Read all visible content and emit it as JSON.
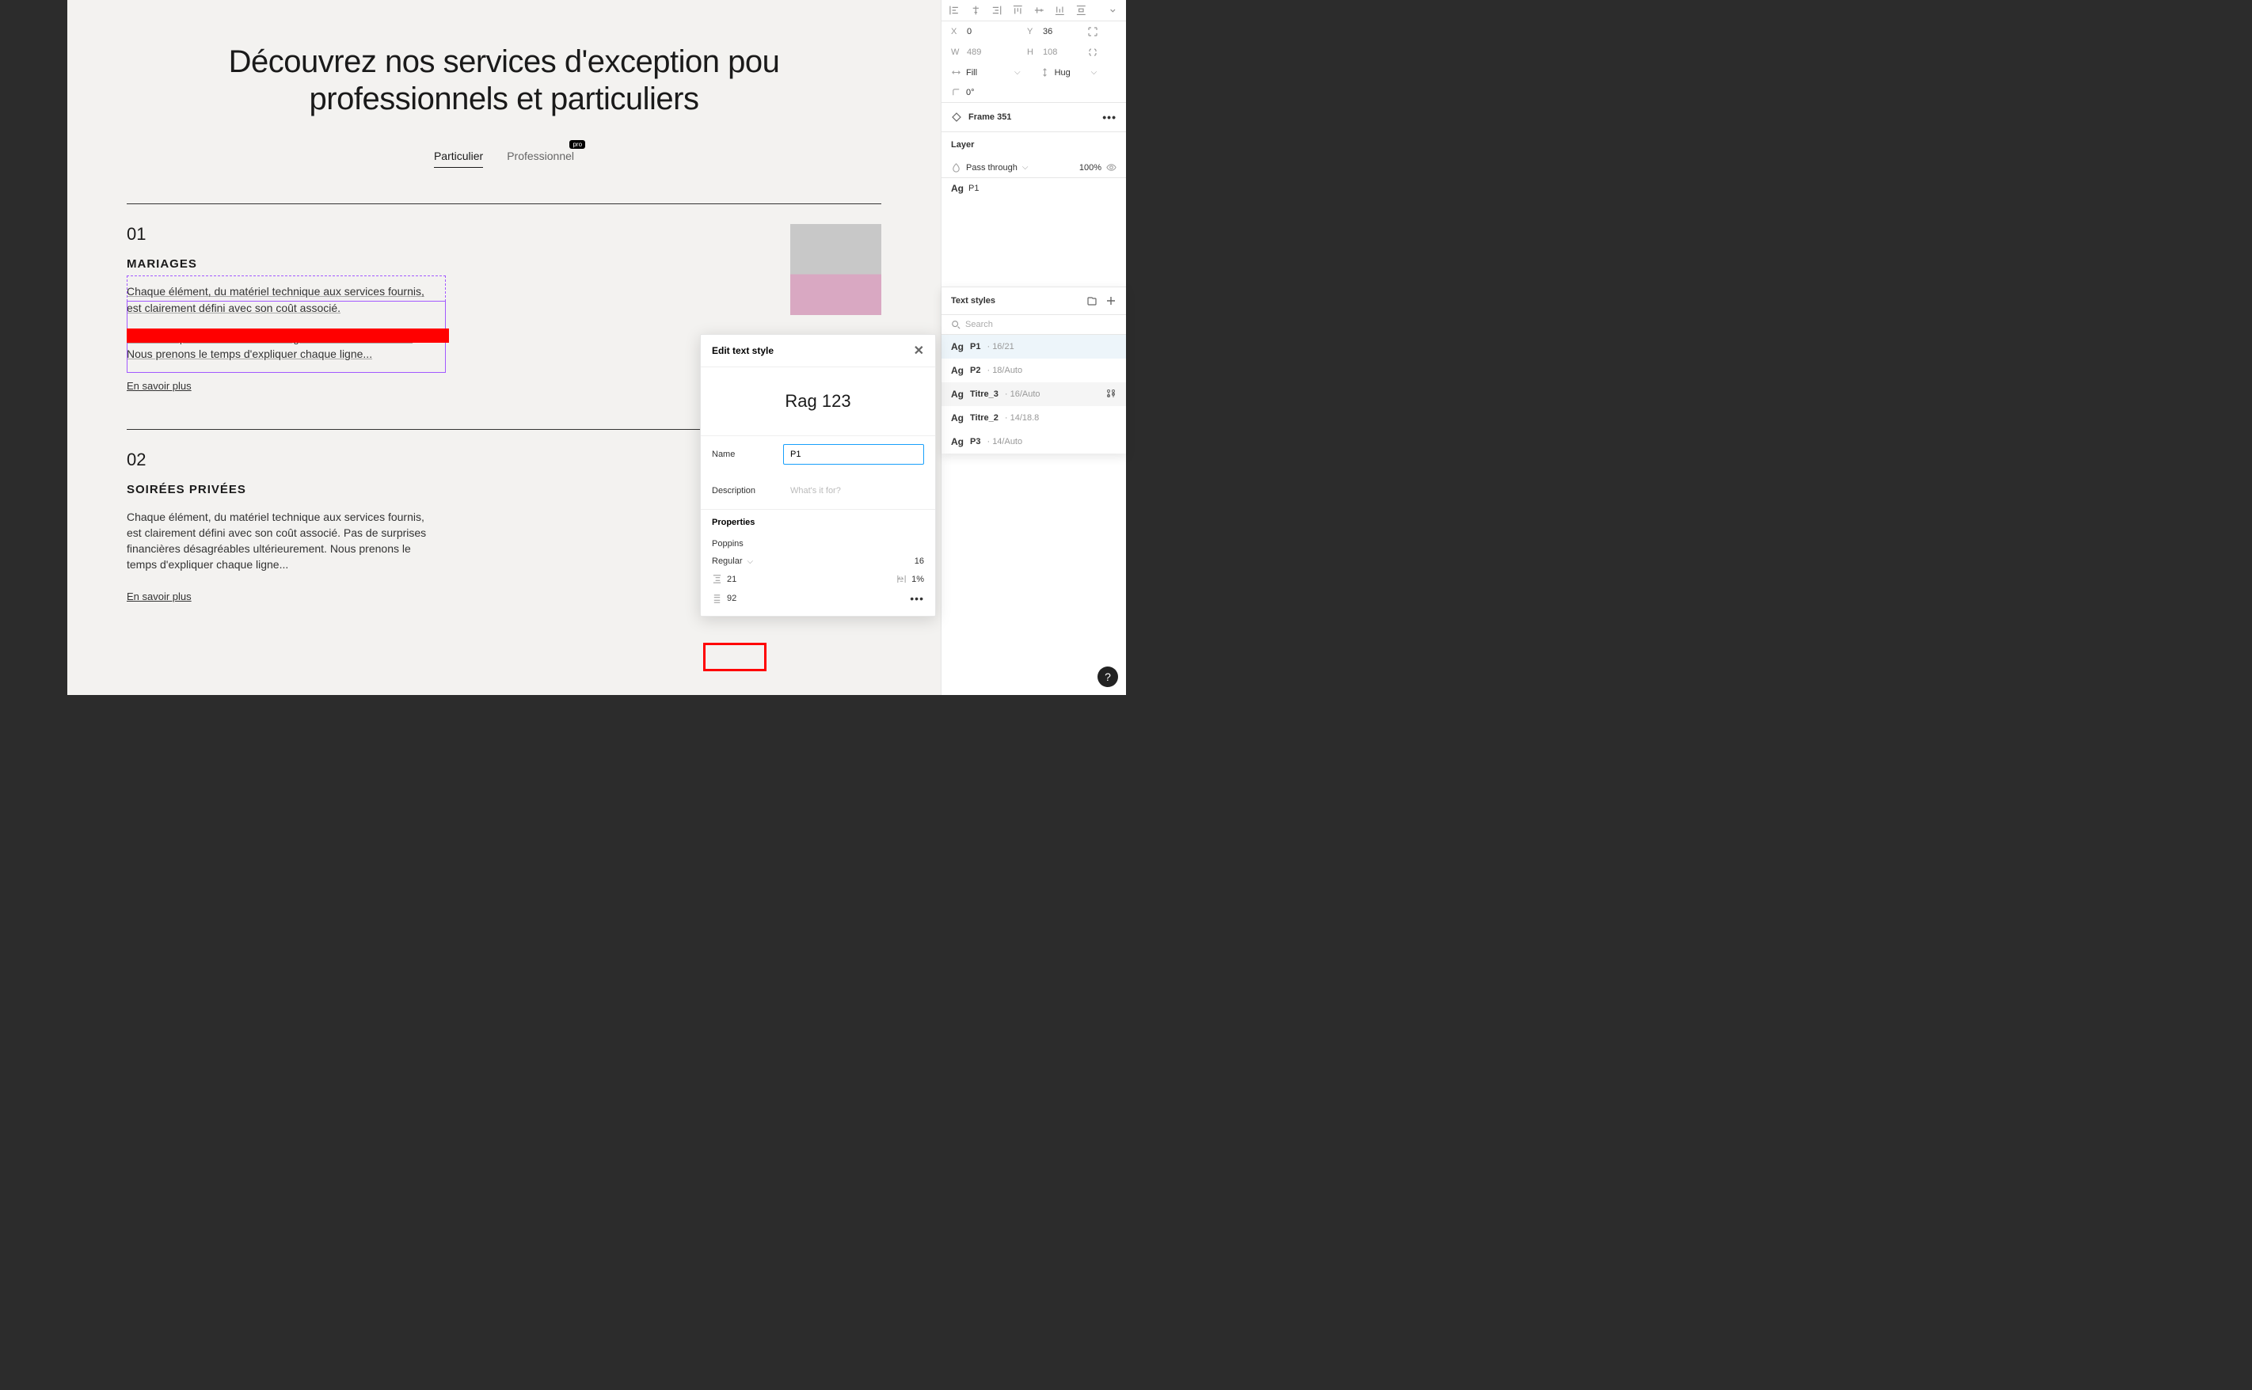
{
  "canvas": {
    "title_line1": "Découvrez nos services d'exception pou",
    "title_line2": "professionnels et particuliers",
    "tabs": {
      "t1": "Particulier",
      "t2": "Professionnel",
      "badge": "pro"
    },
    "section1": {
      "num": "01",
      "title": "MARIAGES",
      "body1": "Chaque élément, du matériel technique aux services fournis, est clairement défini avec son coût associé.",
      "body2": "Pas de surprises financières désagréables ultérieurement. Nous prenons le temps d'expliquer chaque ligne...",
      "link": "En savoir plus"
    },
    "section2": {
      "num": "02",
      "title": "SOIRÉES PRIVÉES",
      "body": "Chaque élément, du matériel technique aux services fournis, est clairement défini avec son coût associé. Pas de surprises financières désagréables ultérieurement. Nous prenons le temps d'expliquer chaque ligne...",
      "link": "En savoir plus"
    }
  },
  "design_panel": {
    "x": "0",
    "y": "36",
    "w": "489",
    "h": "108",
    "resize_w": "Fill",
    "resize_h": "Hug",
    "rotation": "0°",
    "frame_label": "Frame 351",
    "layer_title": "Layer",
    "blend": "Pass through",
    "opacity": "100%",
    "typestyle_label": "P1"
  },
  "text_styles": {
    "title": "Text styles",
    "search_placeholder": "Search",
    "items": [
      {
        "name": "P1",
        "meta": "· 16/21"
      },
      {
        "name": "P2",
        "meta": "· 18/Auto"
      },
      {
        "name": "Titre_3",
        "meta": "· 16/Auto"
      },
      {
        "name": "Titre_2",
        "meta": "· 14/18.8"
      },
      {
        "name": "P3",
        "meta": "· 14/Auto"
      }
    ]
  },
  "popup": {
    "title": "Edit text style",
    "preview": "Rag 123",
    "name_label": "Name",
    "name_value": "P1",
    "desc_label": "Description",
    "desc_placeholder": "What's it for?",
    "props_title": "Properties",
    "font": "Poppins",
    "weight": "Regular",
    "size": "16",
    "line_height": "21",
    "letter_spacing": "1%",
    "paragraph_spacing": "92"
  },
  "help": "?"
}
